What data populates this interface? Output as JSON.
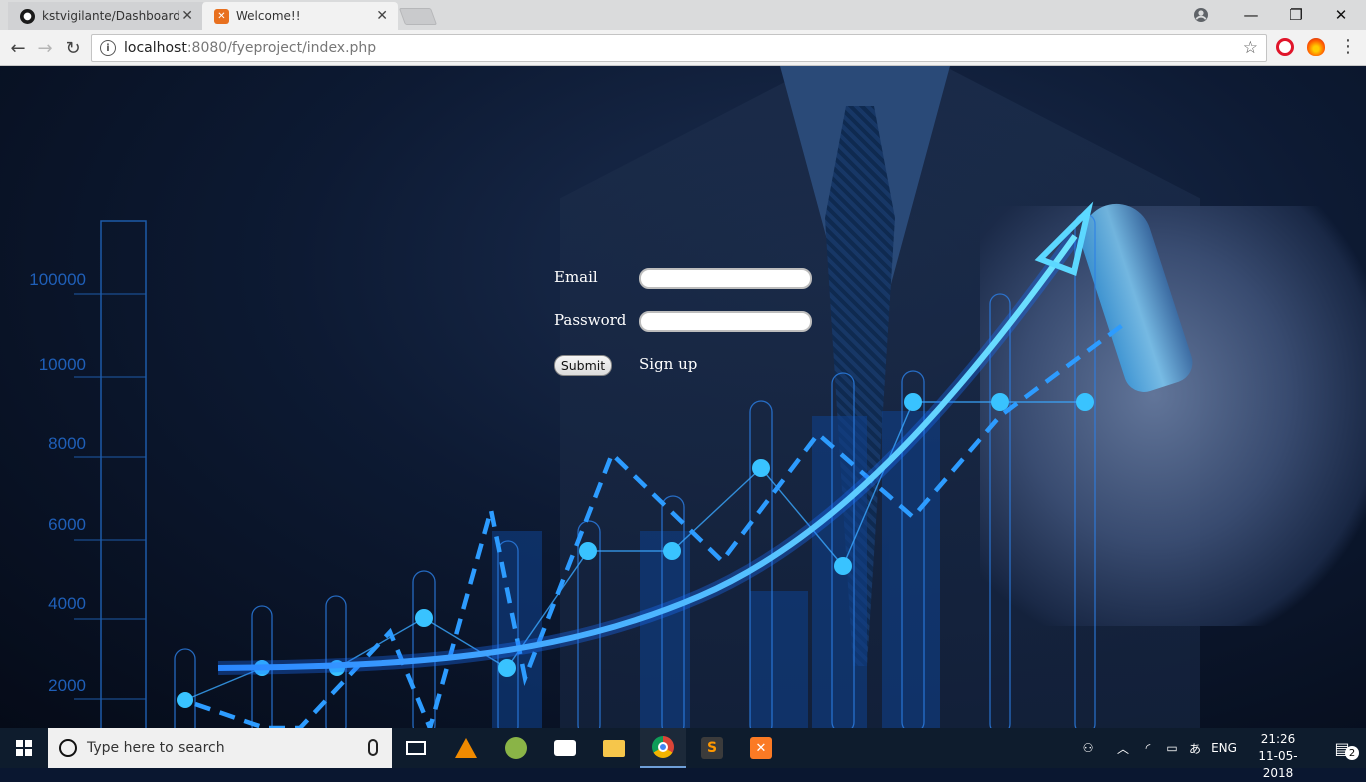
{
  "browser": {
    "tabs": [
      {
        "title": "kstvigilante/Dashboard",
        "icon": "github-icon"
      },
      {
        "title": "Welcome!!",
        "icon": "xampp-icon"
      }
    ],
    "url_host": "localhost",
    "url_rest": ":8080/fyeproject/index.php"
  },
  "form": {
    "email_label": "Email",
    "password_label": "Password",
    "submit_label": "Submit",
    "signup_label": "Sign up"
  },
  "background_chart": {
    "y_tick_labels": [
      "100000",
      "10000",
      "8000",
      "6000",
      "4000",
      "2000"
    ]
  },
  "taskbar": {
    "search_placeholder": "Type here to search",
    "language": "ENG",
    "time": "21:26",
    "date": "11-05-2018",
    "notification_count": "2"
  },
  "colors": {
    "accent": "#1e90ff",
    "glow": "#3fc7ff",
    "page_bg": "#0a1730"
  }
}
